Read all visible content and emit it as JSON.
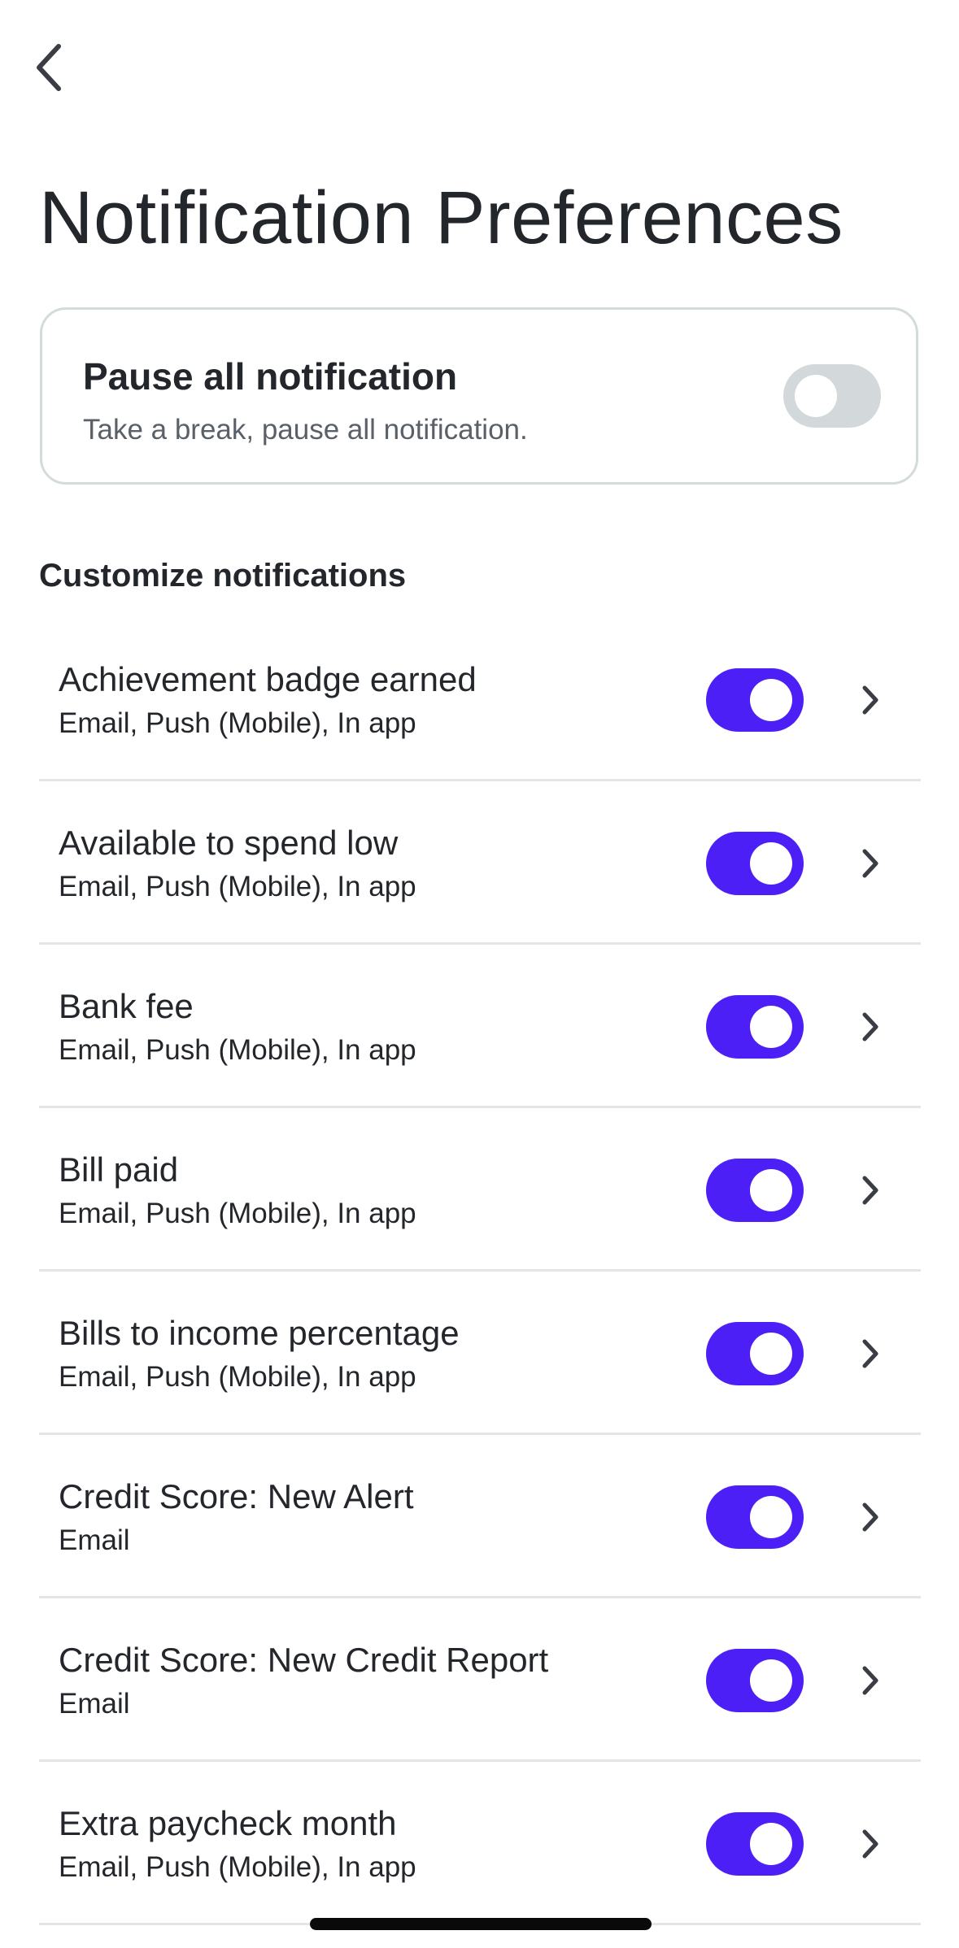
{
  "header": {
    "back_icon": "chevron-left-icon",
    "title": "Notification Preferences"
  },
  "pause_card": {
    "title": "Pause all notification",
    "subtitle": "Take a break, pause all notification.",
    "enabled": false
  },
  "customize": {
    "heading": "Customize notifications",
    "items": [
      {
        "title": "Achievement badge earned",
        "channels": "Email, Push (Mobile), In app",
        "enabled": true
      },
      {
        "title": "Available to spend low",
        "channels": "Email, Push (Mobile), In app",
        "enabled": true
      },
      {
        "title": "Bank fee",
        "channels": "Email, Push (Mobile), In app",
        "enabled": true
      },
      {
        "title": "Bill paid",
        "channels": "Email, Push (Mobile), In app",
        "enabled": true
      },
      {
        "title": "Bills to income percentage",
        "channels": "Email, Push (Mobile), In app",
        "enabled": true
      },
      {
        "title": "Credit Score: New Alert",
        "channels": "Email",
        "enabled": true
      },
      {
        "title": "Credit Score: New Credit Report",
        "channels": "Email",
        "enabled": true
      },
      {
        "title": "Extra paycheck month",
        "channels": "Email, Push (Mobile), In app",
        "enabled": true
      }
    ]
  },
  "colors": {
    "accent": "#4b1ff5",
    "toggle_off": "#d3d9db",
    "text": "#23262b",
    "muted_text": "#5a6068",
    "divider": "#e2e6e7"
  }
}
